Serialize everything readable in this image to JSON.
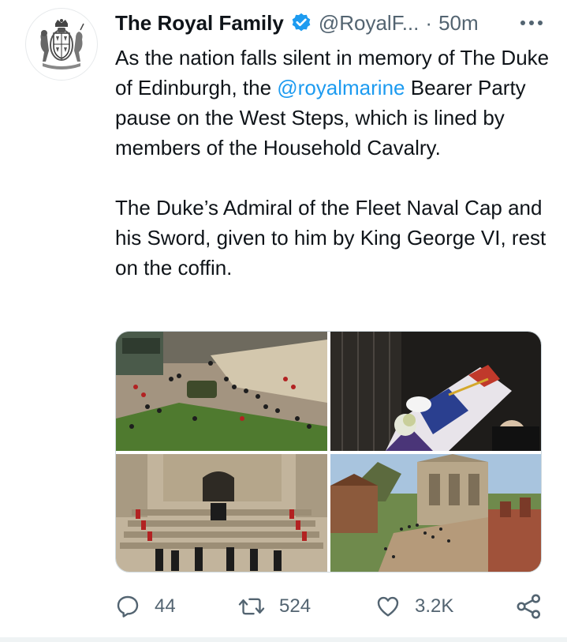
{
  "author": {
    "display_name": "The Royal Family",
    "handle": "@RoyalF...",
    "separator": "·",
    "time": "50m",
    "verified": true,
    "avatar_icon": "royal-coat-of-arms-icon"
  },
  "tweet": {
    "paragraph1_before": "As the nation falls silent in memory of The Duke of Edinburgh, the ",
    "mention": "@royalmarine",
    "paragraph1_after": " Bearer Party pause on the West Steps, which is lined by members of the Household Cavalry.",
    "paragraph2": "The Duke’s Admiral of the Fleet Naval Cap and his Sword, given to him by King George VI, rest on the coffin."
  },
  "media": {
    "photos": [
      {
        "icon": "quadrangle-procession-photo"
      },
      {
        "icon": "coffin-cap-sword-photo"
      },
      {
        "icon": "chapel-steps-photo"
      },
      {
        "icon": "castle-grounds-photo"
      }
    ]
  },
  "actions": {
    "reply_count": "44",
    "retweet_count": "524",
    "like_count": "3.2K"
  },
  "colors": {
    "accent": "#1d9bf0",
    "text": "#0f1419",
    "secondary": "#536471"
  }
}
